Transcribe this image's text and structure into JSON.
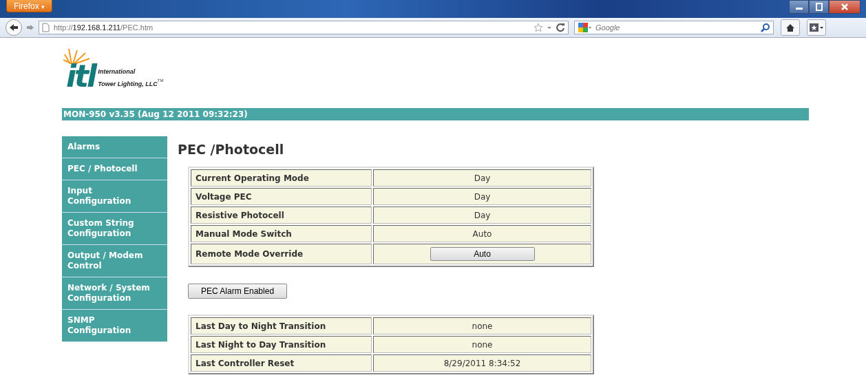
{
  "browser": {
    "app_button": "Firefox",
    "app_button_caret": "▾",
    "url_prefix": "http://",
    "url_host": "192.168.1.211",
    "url_path": "/PEC.htm",
    "search_placeholder": "Google"
  },
  "logo": {
    "mark": "itl",
    "line_1": "International",
    "line_2": "Tower Lighting, LLC",
    "trademark": "TM"
  },
  "header": {
    "title": "MON-950 v3.35 (Aug 12 2011 09:32:23)"
  },
  "sidebar": {
    "items": [
      {
        "label": "Alarms"
      },
      {
        "label": "PEC / Photocell"
      },
      {
        "label": "Input Configuration"
      },
      {
        "label": "Custom String Configuration"
      },
      {
        "label": "Output / Modem Control"
      },
      {
        "label": "Network / System Configuration"
      },
      {
        "label": "SNMP Configuration"
      }
    ]
  },
  "page_title": "PEC /Photocell",
  "status_table": {
    "rows": [
      {
        "label": "Current Operating Mode",
        "kind": "text",
        "value": "Day"
      },
      {
        "label": "Voltage PEC",
        "kind": "text",
        "value": "Day"
      },
      {
        "label": "Resistive Photocell",
        "kind": "text",
        "value": "Day"
      },
      {
        "label": "Manual Mode Switch",
        "kind": "text",
        "value": "Auto"
      },
      {
        "label": "Remote Mode Override",
        "kind": "button",
        "value": "Auto"
      }
    ]
  },
  "alarm_button": "PEC Alarm Enabled",
  "history_table": {
    "rows": [
      {
        "label": "Last Day to Night Transition",
        "kind": "text",
        "value": "none"
      },
      {
        "label": "Last Night to Day Transition",
        "kind": "text",
        "value": "none"
      },
      {
        "label": "Last Controller Reset",
        "kind": "text",
        "value": "8/29/2011 8:34:52"
      }
    ]
  }
}
